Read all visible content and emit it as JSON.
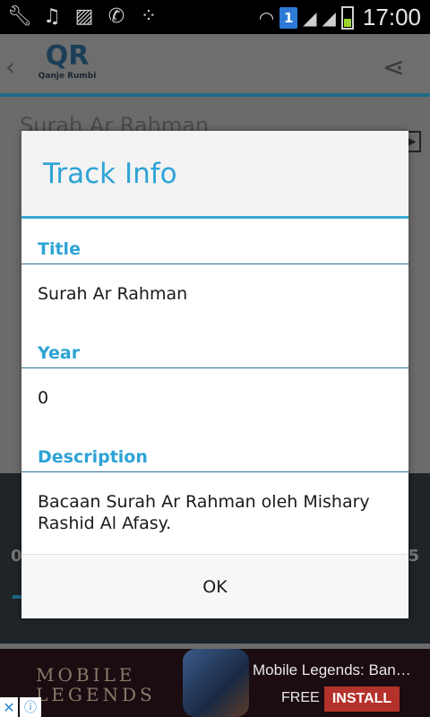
{
  "status_bar": {
    "time": "17:00",
    "sim_slot": "1",
    "left_icons": [
      "wrench-icon",
      "music-icon",
      "image-icon",
      "whatsapp-icon",
      "bbm-icon"
    ],
    "right_icons": [
      "wifi-icon",
      "signal-icon",
      "signal-icon",
      "battery-icon"
    ]
  },
  "app_bar": {
    "logo_initials": "QR",
    "logo_text": "Qanje Rumbi"
  },
  "background": {
    "track_title": "Surah Ar Rahman",
    "left_number": "0",
    "right_number": "5"
  },
  "dialog": {
    "title": "Track Info",
    "fields": [
      {
        "label": "Title",
        "value": "Surah Ar Rahman"
      },
      {
        "label": "Year",
        "value": "0"
      },
      {
        "label": "Description",
        "value": "Bacaan Surah Ar Rahman oleh Mishary Rashid Al Afasy."
      }
    ],
    "ok_label": "OK"
  },
  "ad": {
    "brand_line1": "MOBILE",
    "brand_line2": "LEGENDS",
    "title": "Mobile Legends: Ban…",
    "price": "FREE",
    "install_label": "INSTALL"
  },
  "colors": {
    "accent": "#2ea3d6",
    "divider": "#2e6f9a",
    "install": "#b5312b"
  }
}
